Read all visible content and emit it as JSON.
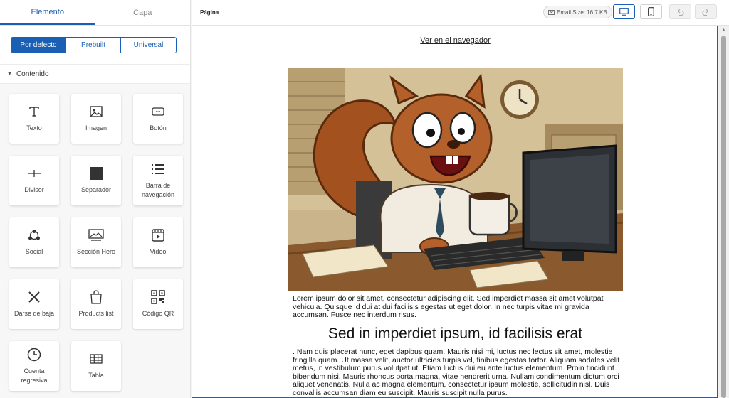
{
  "left_panel": {
    "tabs": [
      {
        "label": "Elemento",
        "active": true
      },
      {
        "label": "Capa",
        "active": false
      }
    ],
    "segments": [
      {
        "label": "Por defecto",
        "active": true
      },
      {
        "label": "Prebuilt",
        "active": false
      },
      {
        "label": "Universal",
        "active": false
      }
    ],
    "section": "Contenido",
    "tiles": [
      {
        "label": "Texto",
        "icon": "text-icon"
      },
      {
        "label": "Imagen",
        "icon": "image-icon"
      },
      {
        "label": "Botón",
        "icon": "button-icon"
      },
      {
        "label": "Divisor",
        "icon": "divider-icon"
      },
      {
        "label": "Separador",
        "icon": "separator-icon"
      },
      {
        "label": "Barra de navegación",
        "icon": "navbar-icon"
      },
      {
        "label": "Social",
        "icon": "social-icon"
      },
      {
        "label": "Sección Hero",
        "icon": "hero-icon"
      },
      {
        "label": "Video",
        "icon": "video-icon"
      },
      {
        "label": "Darse de baja",
        "icon": "unsubscribe-icon"
      },
      {
        "label": "Products list",
        "icon": "bag-icon"
      },
      {
        "label": "Código QR",
        "icon": "qr-icon"
      },
      {
        "label": "Cuenta regresiva",
        "icon": "clock-icon"
      },
      {
        "label": "Tabla",
        "icon": "table-icon"
      }
    ]
  },
  "topbar": {
    "title": "Página",
    "email_size": "Email Size: 16.7 KB"
  },
  "canvas": {
    "view_link": "Ver en el navegador",
    "paragraph1": "Lorem ipsum dolor sit amet, consectetur adipiscing elit. Sed imperdiet massa sit amet volutpat vehicula. Quisque id dui at dui facilisis egestas ut eget dolor. In nec turpis vitae mi gravida accumsan. Fusce nec interdum risus.",
    "heading": "Sed in imperdiet ipsum, id facilisis erat",
    "paragraph2": ". Nam quis placerat nunc, eget dapibus quam. Mauris nisi mi, luctus nec lectus sit amet, molestie fringilla quam. Ut massa velit, auctor ultricies turpis vel, finibus egestas tortor. Aliquam sodales velit metus, in vestibulum purus volutpat ut. Etiam luctus dui eu ante luctus elementum. Proin tincidunt bibendum nisi. Mauris rhoncus porta magna, vitae hendrerit urna. Nullam condimentum dictum orci aliquet venenatis. Nulla ac magna elementum, consectetur ipsum molestie, sollicitudin nisl. Duis convallis accumsan diam eu suscipit. Mauris suscipit nulla purus."
  },
  "colors": {
    "accent": "#1a5fb4"
  }
}
